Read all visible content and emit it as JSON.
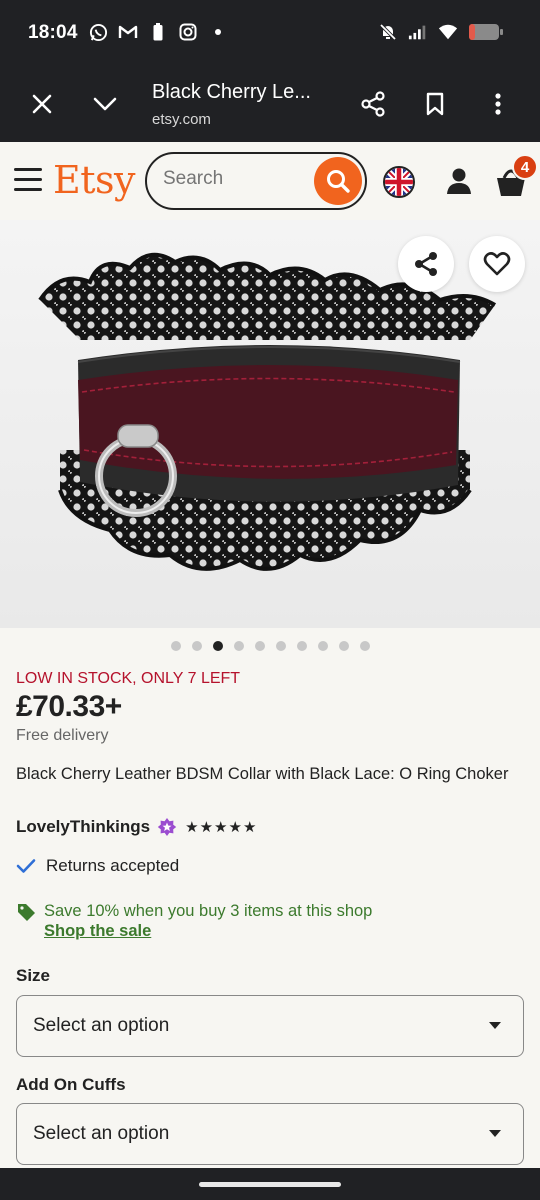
{
  "status_bar": {
    "time": "18:04",
    "left_icons": [
      "whatsapp-icon",
      "gmail-icon",
      "battery-small-icon",
      "instagram-icon",
      "dot-icon"
    ],
    "right_icons": [
      "mute-icon",
      "signal-icon",
      "wifi-icon",
      "battery-icon"
    ]
  },
  "browser": {
    "title": "Black Cherry Le...",
    "url": "etsy.com"
  },
  "header": {
    "logo": "Etsy",
    "search_placeholder": "Search",
    "cart_count": "4",
    "brand_color": "#f1641e"
  },
  "gallery": {
    "image_count": 10,
    "active_index": 2
  },
  "product": {
    "stock": "LOW IN STOCK, ONLY 7 LEFT",
    "price": "£70.33+",
    "delivery": "Free delivery",
    "title": "Black Cherry Leather BDSM Collar with Black Lace: O Ring Choker",
    "shop": "LovelyThinkings",
    "rating_stars": 5,
    "returns": "Returns accepted",
    "promo": "Save 10% when you buy 3 items at this shop",
    "promo_link": "Shop the sale"
  },
  "options": [
    {
      "label": "Size",
      "value": "Select an option"
    },
    {
      "label": "Add On Cuffs",
      "value": "Select an option"
    }
  ],
  "colors": {
    "stock": "#b5122c",
    "promo": "#3c7a2d",
    "star_seller": "#9b4dd0",
    "check": "#2f6fd6"
  }
}
